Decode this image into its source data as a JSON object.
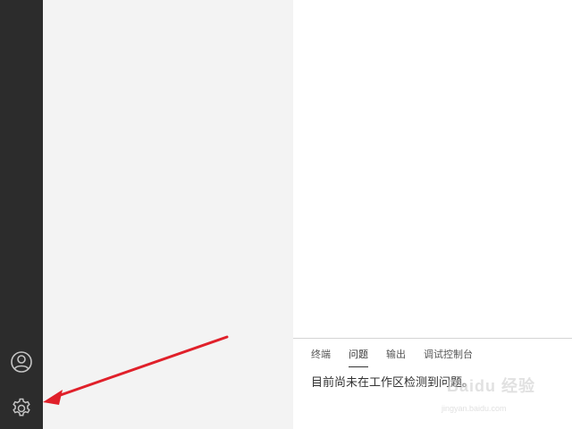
{
  "activity_bar": {
    "account_icon": "account-circle-icon",
    "manage_icon": "gear-icon"
  },
  "panel": {
    "tabs": [
      {
        "label": "终端"
      },
      {
        "label": "问题"
      },
      {
        "label": "输出"
      },
      {
        "label": "调试控制台"
      }
    ],
    "active_tab": "问题",
    "message": "目前尚未在工作区检测到问题。"
  },
  "annotation": {
    "arrow_color": "#e0202a"
  },
  "watermark": {
    "brand": "Baidu 经验",
    "url": "jingyan.baidu.com"
  },
  "colors": {
    "activity_bar": "#2c2c2c",
    "sidebar": "#f3f3f3",
    "editor": "#ffffff"
  }
}
